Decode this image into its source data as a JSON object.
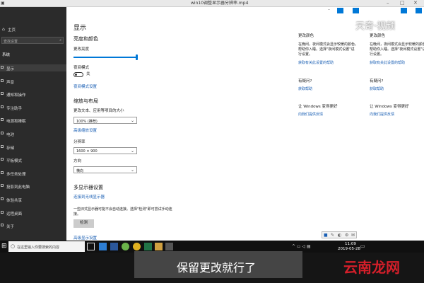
{
  "video": {
    "title": "win10调整显示器分辨率.mp4",
    "subtitle": "保留更改就行了",
    "watermark_top": "天奇·视频",
    "watermark_bottom": "云南龙网"
  },
  "window": {
    "left_nav": {
      "home_label": "主页",
      "search_placeholder": "查找设置",
      "section": "系统",
      "items": [
        {
          "label": "显示",
          "icon": "monitor-icon"
        },
        {
          "label": "声音",
          "icon": "speaker-icon"
        },
        {
          "label": "通知和操作",
          "icon": "notification-icon"
        },
        {
          "label": "专注助手",
          "icon": "moon-icon"
        },
        {
          "label": "电源和睡眠",
          "icon": "power-icon"
        },
        {
          "label": "电池",
          "icon": "battery-icon"
        },
        {
          "label": "存储",
          "icon": "storage-icon"
        },
        {
          "label": "平板模式",
          "icon": "tablet-icon"
        },
        {
          "label": "多任务处理",
          "icon": "multitask-icon"
        },
        {
          "label": "投影到此电脑",
          "icon": "project-icon"
        },
        {
          "label": "体验共享",
          "icon": "share-icon"
        },
        {
          "label": "远程桌面",
          "icon": "remote-icon"
        },
        {
          "label": "关于",
          "icon": "info-icon"
        }
      ]
    },
    "main": {
      "title": "显示",
      "section_color": "亮度和颜色",
      "brightness_label": "更改亮度",
      "brightness_level": 1.0,
      "night_light_label": "夜间模式",
      "night_light_state": "关",
      "night_light_link": "夜间模式设置",
      "section_scale": "缩放与布局",
      "scale_label": "更改文本、应用等项目的大小",
      "scale_value": "100% (推荐)",
      "advanced_scale_link": "高级缩放设置",
      "resolution_label": "分辨率",
      "resolution_value": "1600 × 900",
      "orientation_label": "方向",
      "orientation_value": "横向",
      "section_multi": "多显示器设置",
      "connect_wireless_link": "连接到无线显示器",
      "detect_desc_line1": "一些旧式显示器可能不会自动连接。选择\"检测\"即可尝试手动连",
      "detect_desc_line2": "接。",
      "detect_button": "检测",
      "advanced_display_link": "高级显示设置"
    },
    "right_panel": {
      "heading": "更改颜色",
      "desc_lines": [
        "在晚间，夜间模式会显示较暖的颜色，",
        "帮助你入睡。选择\"夜间模式设置\"进",
        "行设置。"
      ],
      "link1": "获取有关此设置的帮助",
      "question": "有疑问?",
      "help_link": "获取帮助",
      "improve": "让 Windows 变得更好",
      "feedback_link": "向我们提供反馈"
    }
  },
  "taskbar": {
    "search_placeholder": "在这里输入你要搜索的内容",
    "time": "11:09",
    "date": "2019-05-28"
  }
}
